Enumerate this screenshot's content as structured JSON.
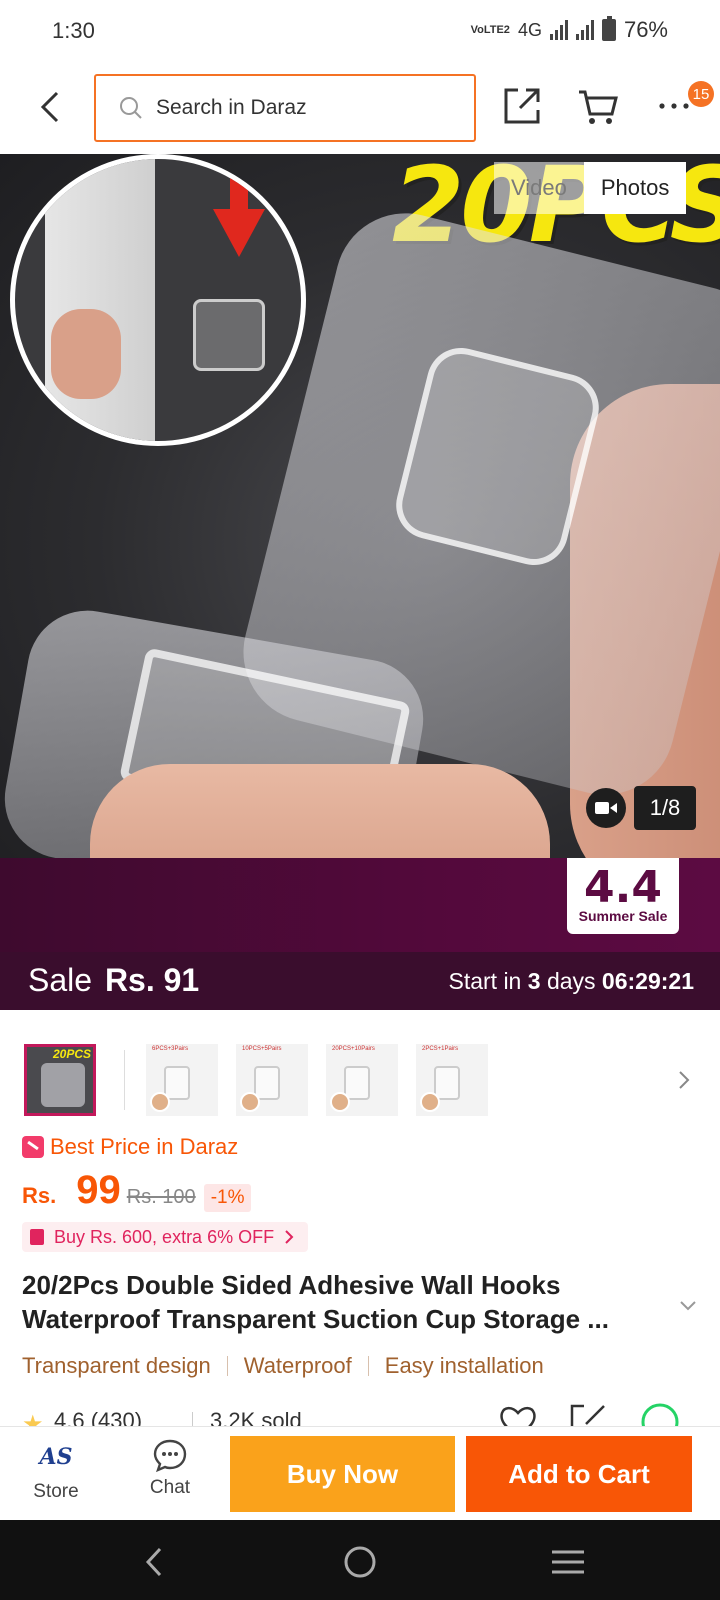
{
  "status_bar": {
    "time": "1:30",
    "volte": "VoLTE2",
    "network": "4G",
    "battery": "76%"
  },
  "header": {
    "search_placeholder": "Search in Daraz",
    "cart_badge": "15",
    "icons": [
      "back-arrow-icon",
      "search-icon",
      "share-icon",
      "cart-icon",
      "more-icon"
    ]
  },
  "gallery": {
    "headline_text": "20PCS",
    "toggle_video": "Video",
    "toggle_photos": "Photos",
    "counter": "1/8",
    "active_toggle": "Photos"
  },
  "campaign": {
    "sticker_big": "4.4",
    "sticker_small": "Summer Sale",
    "sale_label": "Sale",
    "sale_price": "Rs. 91",
    "start_prefix": "Start in",
    "start_days": "3",
    "start_days_unit": "days",
    "countdown": "06:29:21"
  },
  "thumbnails": [
    {
      "label": "20PCS",
      "active": true
    },
    {
      "label": "6PCS+3Pairs",
      "active": false
    },
    {
      "label": "10PCS+5Pairs",
      "active": false
    },
    {
      "label": "20PCS+10Pairs",
      "active": false
    },
    {
      "label": "2PCS+1Pairs",
      "active": false
    }
  ],
  "pricing": {
    "best_price_text": "Best Price in Daraz",
    "currency": "Rs.",
    "price": "99",
    "original_price": "Rs. 100",
    "discount": "-1%",
    "promo_text": "Buy Rs. 600, extra 6% OFF"
  },
  "product": {
    "title": "20/2Pcs Double Sided Adhesive Wall Hooks Waterproof Transparent Suction Cup Storage ...",
    "features": [
      "Transparent design",
      "Waterproof",
      "Easy installation"
    ],
    "rating": "4.6 (430)",
    "sold": "3.2K sold"
  },
  "bottom_bar": {
    "store_label": "Store",
    "store_logo": "AS",
    "chat_label": "Chat",
    "buy_now": "Buy Now",
    "add_to_cart": "Add to Cart"
  },
  "colors": {
    "accent_orange": "#f85606",
    "buy_now_yellow": "#faa21b",
    "campaign_purple": "#53093b",
    "feature_brown": "#a0612e"
  }
}
